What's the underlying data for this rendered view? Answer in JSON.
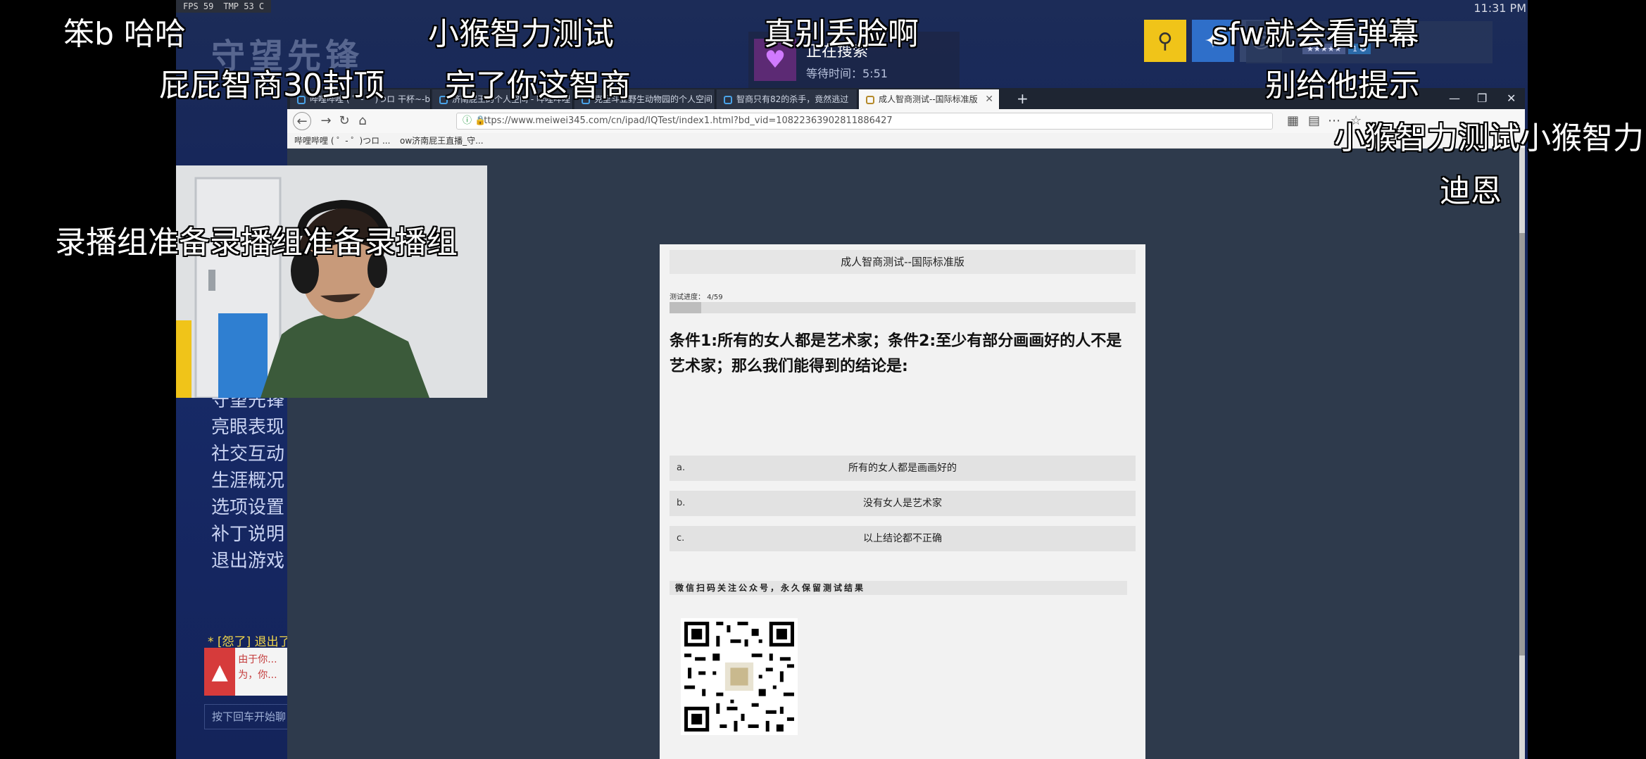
{
  "overlay": {
    "fps": "FPS   59",
    "temp": "TMP   53 C",
    "clock": "11:31 PM"
  },
  "game": {
    "logo_text": "守望先锋",
    "search": {
      "status": "正在搜索",
      "wait": "等待时间：5:51"
    },
    "menu": [
      "守望先锋",
      "亮眼表现",
      "社交互动",
      "生涯概况",
      "选项设置",
      "补丁说明",
      "退出游戏"
    ],
    "exit_notice": "* [怨了] 退出了",
    "error_text": "由于你... 为，你...",
    "chat_placeholder": "按下回车开始聊"
  },
  "browser": {
    "tabs": [
      "哔哩哔哩 ( ゜- ゜)つロ 干杯~-b",
      "济南屁王的个人空间 - 哔哩哔哩",
      "克里斗亚野生动物园的个人空间",
      "智商只有82的杀手，竟然逃过",
      "成人智商测试--国际标准版"
    ],
    "url": "https://www.meiwei345.com/cn/ipad/IQTest/index1.html?bd_vid=10822363902811886427",
    "bookmarks": [
      "哔哩哔哩 ( ゜- ゜)つロ ...",
      "ow济南屁王直播_守..."
    ]
  },
  "quiz": {
    "title": "成人智商测试--国际标准版",
    "progress_label": "测试进度：  4/59",
    "progress": 0.068,
    "question": "条件1:所有的女人都是艺术家；条件2:至少有部分画画好的人不是艺术家；那么我们能得到的结论是:",
    "options": [
      {
        "letter": "a.",
        "text": "所有的女人都是画画好的"
      },
      {
        "letter": "b.",
        "text": "没有女人是艺术家"
      },
      {
        "letter": "c.",
        "text": "以上结论都不正确"
      }
    ],
    "wechat_note": "微信扫码关注公众号，永久保留测试结果"
  },
  "danmaku": [
    "笨b 哈哈",
    "小猴智力测试",
    "真别丢脸啊",
    "sfw就会看弹幕",
    "屁屁智商30封顶",
    "完了你这智商",
    "别给他提示",
    "小猴智力测试小猴智力",
    "迪恩",
    "录播组准备录播组准备录播组"
  ]
}
